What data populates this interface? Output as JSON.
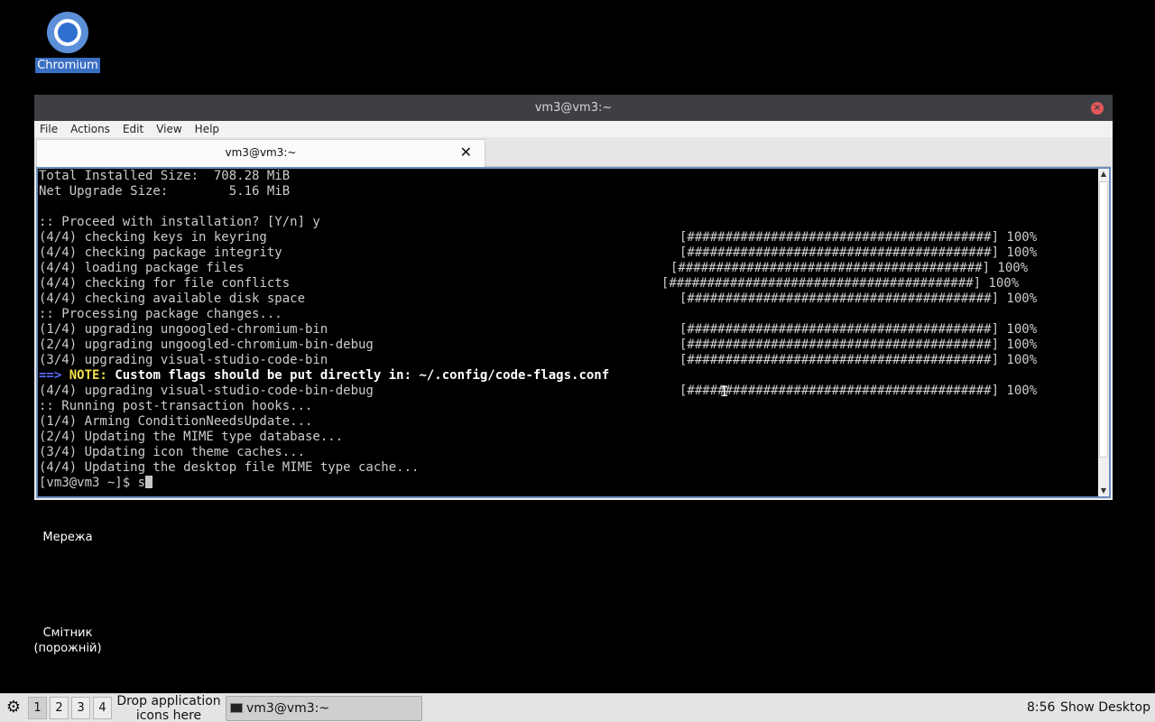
{
  "desktop": {
    "chromium_label": "Chromium",
    "network_label": "Мережа",
    "trash_label_1": "Смітник",
    "trash_label_2": "(порожній)"
  },
  "window": {
    "title": "vm3@vm3:~",
    "menu": [
      "File",
      "Actions",
      "Edit",
      "View",
      "Help"
    ],
    "tab_title": "vm3@vm3:~"
  },
  "terminal": {
    "lines": [
      {
        "text": "Total Installed Size:  708.28 MiB",
        "bar": ""
      },
      {
        "text": "Net Upgrade Size:        5.16 MiB",
        "bar": ""
      },
      {
        "text": "",
        "bar": ""
      },
      {
        "text": ":: Proceed with installation? [Y/n] y",
        "bar": ""
      },
      {
        "text": "(4/4) checking keys in keyring",
        "bar": "[########################################] 100%"
      },
      {
        "text": "(4/4) checking package integrity",
        "bar": "[########################################] 100%"
      },
      {
        "text": "(4/4) loading package files",
        "bar": "[########################################] 100%"
      },
      {
        "text": "(4/4) checking for file conflicts",
        "bar": "[########################################] 100%"
      },
      {
        "text": "(4/4) checking available disk space",
        "bar": "[########################################] 100%"
      },
      {
        "text": ":: Processing package changes...",
        "bar": ""
      },
      {
        "text": "(1/4) upgrading ungoogled-chromium-bin",
        "bar": "[########################################] 100%"
      },
      {
        "text": "(2/4) upgrading ungoogled-chromium-bin-debug",
        "bar": "[########################################] 100%"
      },
      {
        "text": "(3/4) upgrading visual-studio-code-bin",
        "bar": "[########################################] 100%"
      },
      {
        "text": "",
        "bar": ""
      },
      {
        "text": "(4/4) upgrading visual-studio-code-bin-debug",
        "bar": "[########################################] 100%"
      },
      {
        "text": ":: Running post-transaction hooks...",
        "bar": ""
      },
      {
        "text": "(1/4) Arming ConditionNeedsUpdate...",
        "bar": ""
      },
      {
        "text": "(2/4) Updating the MIME type database...",
        "bar": ""
      },
      {
        "text": "(3/4) Updating icon theme caches...",
        "bar": ""
      },
      {
        "text": "(4/4) Updating the desktop file MIME type cache...",
        "bar": ""
      }
    ],
    "note_arrow": "==>",
    "note_label": "NOTE:",
    "note_text": "Custom flags should be put directly in: ~/.config/code-flags.conf",
    "prompt": "[vm3@vm3 ~]$ ",
    "input": "s"
  },
  "taskbar": {
    "workspaces": [
      "1",
      "2",
      "3",
      "4"
    ],
    "drop_line_1": "Drop application",
    "drop_line_2": "icons here",
    "task_label": "vm3@vm3:~",
    "clock": "8:56",
    "show_desktop": "Show Desktop"
  }
}
